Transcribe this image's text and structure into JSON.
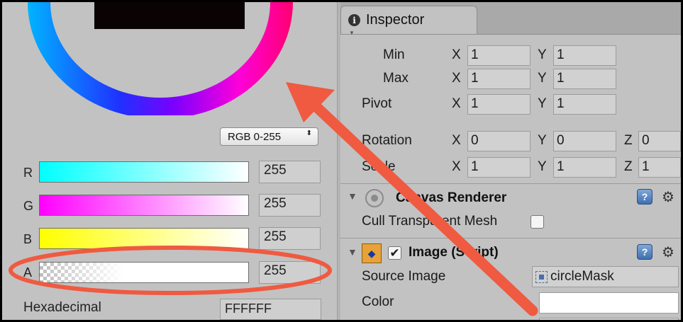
{
  "color_picker": {
    "mode": "RGB 0-255",
    "mode_arrows": "⬍",
    "channels": [
      {
        "label": "R",
        "value": "255"
      },
      {
        "label": "G",
        "value": "255"
      },
      {
        "label": "B",
        "value": "255"
      },
      {
        "label": "A",
        "value": "255"
      }
    ],
    "hex_label": "Hexadecimal",
    "hex_value": "FFFFFF"
  },
  "inspector": {
    "tab_label": "Inspector",
    "info_glyph": "i",
    "rect": {
      "min_label": "Min",
      "max_label": "Max",
      "pivot_label": "Pivot",
      "rotation_label": "Rotation",
      "scale_label": "Scale",
      "x_axis": "X",
      "y_axis": "Y",
      "z_axis": "Z",
      "min": {
        "x": "1",
        "y": "1"
      },
      "max": {
        "x": "1",
        "y": "1"
      },
      "pivot": {
        "x": "1",
        "y": "1"
      },
      "rotation": {
        "x": "0",
        "y": "0",
        "z": "0"
      },
      "scale": {
        "x": "1",
        "y": "1",
        "z": "1"
      }
    },
    "canvas_renderer": {
      "title": "Canvas Renderer",
      "cull_label": "Cull Transparent Mesh"
    },
    "image": {
      "title": "Image (Script)",
      "source_image_label": "Source Image",
      "source_image_value": "circleMask",
      "color_label": "Color"
    },
    "help_glyph": "?",
    "settings_glyph": "⚙",
    "check_glyph": "✔",
    "fold_glyph": "▼"
  },
  "colors": {
    "annotation": "#ef5a41",
    "panel_bg": "#c2c2c2"
  }
}
